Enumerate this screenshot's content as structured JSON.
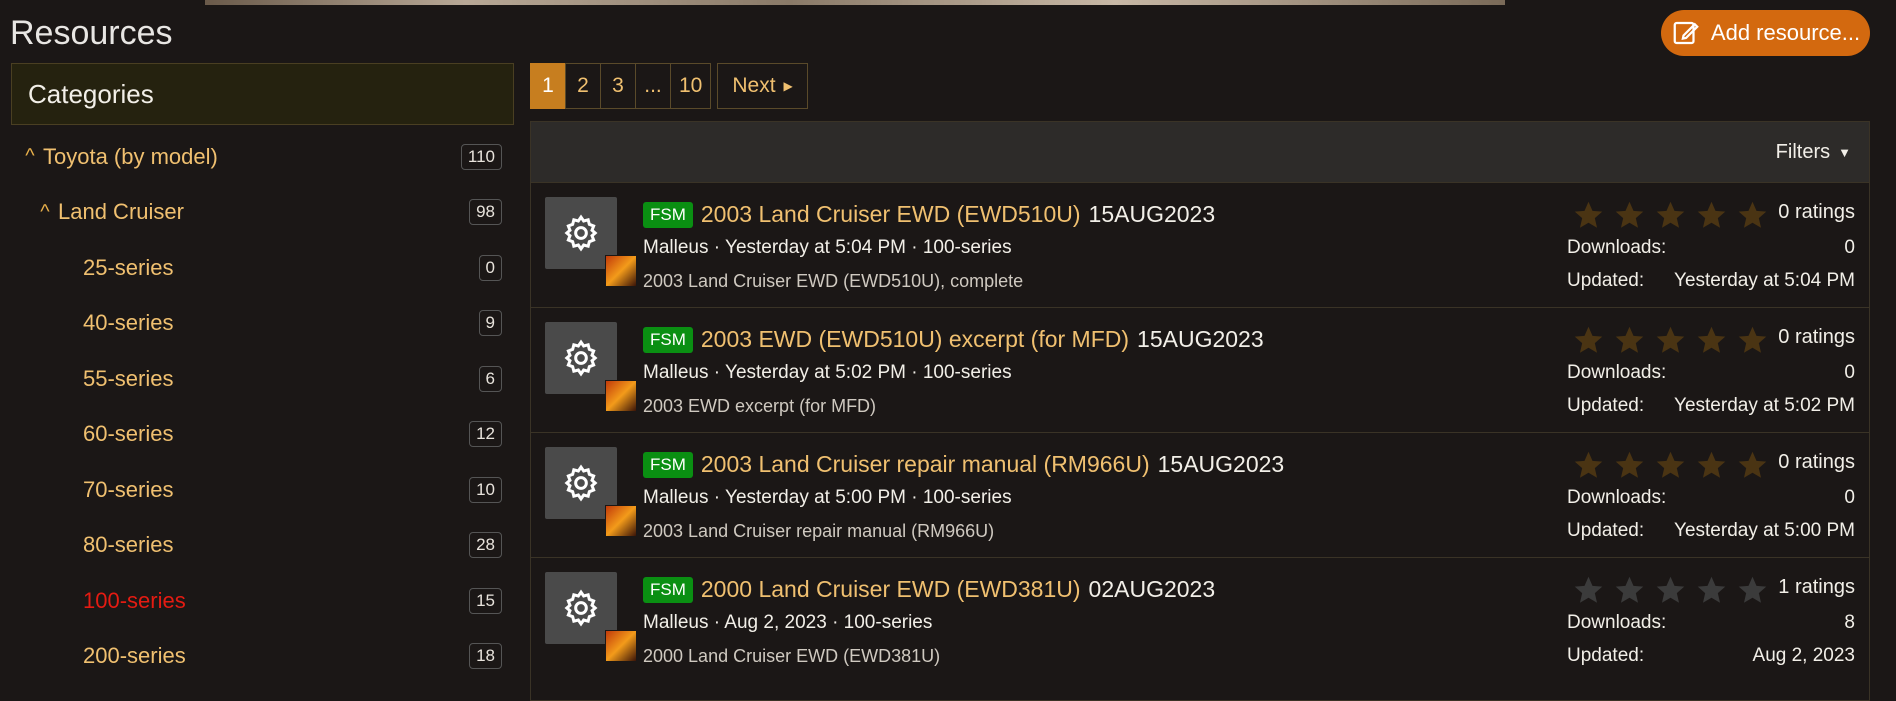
{
  "page": {
    "title": "Resources",
    "add_label": "Add resource..."
  },
  "sidebar": {
    "heading": "Categories",
    "items": [
      {
        "label": "Toyota (by model)",
        "count": "110"
      },
      {
        "label": "Land Cruiser",
        "count": "98"
      },
      {
        "label": "25-series",
        "count": "0"
      },
      {
        "label": "40-series",
        "count": "9"
      },
      {
        "label": "55-series",
        "count": "6"
      },
      {
        "label": "60-series",
        "count": "12"
      },
      {
        "label": "70-series",
        "count": "10"
      },
      {
        "label": "80-series",
        "count": "28"
      },
      {
        "label": "100-series",
        "count": "15"
      },
      {
        "label": "200-series",
        "count": "18"
      }
    ]
  },
  "pager": {
    "pages": [
      "1",
      "2",
      "3",
      "...",
      "10"
    ],
    "current": "1",
    "next_label": "Next"
  },
  "filters_label": "Filters",
  "resources": [
    {
      "badge": "FSM",
      "title": "2003 Land Cruiser EWD (EWD510U)",
      "version": "15AUG2023",
      "meta": "Malleus · Yesterday at 5:04 PM · 100-series",
      "desc": "2003 Land Cruiser EWD (EWD510U), complete",
      "ratings": "0 ratings",
      "rating_value": 0,
      "downloads_label": "Downloads:",
      "downloads": "0",
      "updated_label": "Updated:",
      "updated": "Yesterday at 5:04 PM"
    },
    {
      "badge": "FSM",
      "title": "2003 EWD (EWD510U) excerpt (for MFD)",
      "version": "15AUG2023",
      "meta": "Malleus · Yesterday at 5:02 PM · 100-series",
      "desc": "2003 EWD excerpt (for MFD)",
      "ratings": "0 ratings",
      "rating_value": 0,
      "downloads_label": "Downloads:",
      "downloads": "0",
      "updated_label": "Updated:",
      "updated": "Yesterday at 5:02 PM"
    },
    {
      "badge": "FSM",
      "title": "2003 Land Cruiser repair manual (RM966U)",
      "version": "15AUG2023",
      "meta": "Malleus · Yesterday at 5:00 PM · 100-series",
      "desc": "2003 Land Cruiser repair manual (RM966U)",
      "ratings": "0 ratings",
      "rating_value": 0,
      "downloads_label": "Downloads:",
      "downloads": "0",
      "updated_label": "Updated:",
      "updated": "Yesterday at 5:00 PM"
    },
    {
      "badge": "FSM",
      "title": "2000 Land Cruiser EWD (EWD381U)",
      "version": "02AUG2023",
      "meta": "Malleus · Aug 2, 2023 · 100-series",
      "desc": "2000 Land Cruiser EWD (EWD381U)",
      "ratings": "1 ratings",
      "rating_value": 0,
      "downloads_label": "Downloads:",
      "downloads": "8",
      "updated_label": "Updated:",
      "updated": "Aug 2, 2023"
    }
  ],
  "colors": {
    "accent": "#d3690f",
    "link": "#f0c070",
    "active": "#e41b12",
    "badge": "#0a8f12"
  }
}
